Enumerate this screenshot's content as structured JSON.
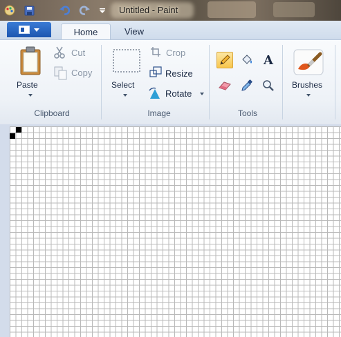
{
  "window": {
    "title": "Untitled - Paint"
  },
  "quick_access": {
    "icons": [
      "paint-app-icon",
      "save-icon",
      "undo-icon",
      "redo-icon",
      "customize-qat-icon"
    ]
  },
  "tabs": [
    {
      "label": "Home",
      "selected": true
    },
    {
      "label": "View",
      "selected": false
    }
  ],
  "ribbon": {
    "clipboard": {
      "label": "Clipboard",
      "paste": "Paste",
      "cut": "Cut",
      "copy": "Copy"
    },
    "image": {
      "label": "Image",
      "select": "Select",
      "crop": "Crop",
      "resize": "Resize",
      "rotate": "Rotate"
    },
    "tools": {
      "label": "Tools",
      "items": [
        "pencil-icon",
        "fill-icon",
        "text-icon",
        "eraser-icon",
        "color-picker-icon",
        "magnifier-icon"
      ],
      "active": "pencil-icon",
      "text_glyph": "A"
    },
    "brushes": {
      "label": "Brushes"
    }
  },
  "canvas": {
    "grid": true,
    "pixels_filled": [
      [
        1,
        0
      ],
      [
        0,
        1
      ]
    ]
  },
  "colors": {
    "accent_blue": "#1d56b0",
    "active_tool": "#f8c64d",
    "grid_line": "#b9b9b9"
  }
}
